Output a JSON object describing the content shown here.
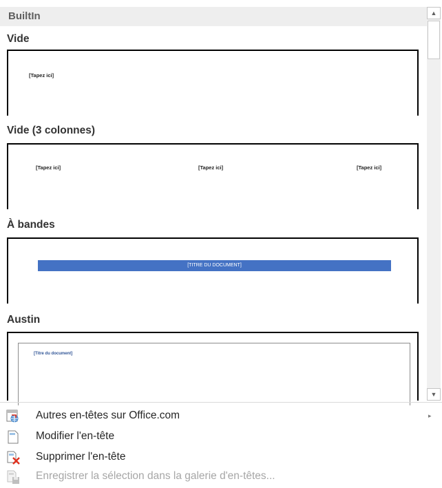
{
  "gallery": {
    "group_label": "BuiltIn",
    "items": [
      {
        "title": "Vide",
        "placeholders": [
          "[Tapez ici]"
        ]
      },
      {
        "title": "Vide (3 colonnes)",
        "placeholders": [
          "[Tapez ici]",
          "[Tapez ici]",
          "[Tapez ici]"
        ]
      },
      {
        "title": "À bandes",
        "band_text": "[TITRE DU DOCUMENT]",
        "band_color": "#4472c4"
      },
      {
        "title": "Austin",
        "doc_title": "[Titre du document]"
      }
    ]
  },
  "scrollbar": {
    "up_glyph": "▲",
    "down_glyph": "▼"
  },
  "menu": {
    "items": [
      {
        "label": "Autres en-têtes sur Office.com",
        "icon": "office-globe-icon",
        "submenu_glyph": "▸",
        "enabled": true
      },
      {
        "label": "Modifier l'en-tête",
        "icon": "edit-header-icon",
        "enabled": true
      },
      {
        "label": "Supprimer l'en-tête",
        "icon": "remove-header-icon",
        "enabled": true
      },
      {
        "label": "Enregistrer la sélection dans la galerie d'en-têtes...",
        "icon": "save-to-gallery-icon",
        "enabled": false
      }
    ]
  },
  "colors": {
    "accent_blue": "#4472c4",
    "delete_red": "#e0301e"
  }
}
